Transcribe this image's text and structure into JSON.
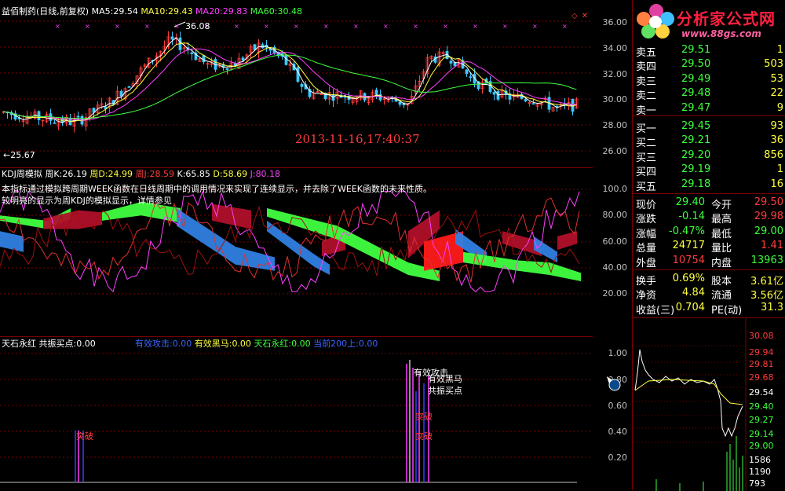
{
  "colors": {
    "bg": "#000000",
    "up": "#ff3c3c",
    "down": "#3cc8ff",
    "ma5": "#ffffff",
    "ma10": "#ffff40",
    "ma20": "#ff40ff",
    "ma60": "#40ff40",
    "grid": "#7a0000"
  },
  "main": {
    "title": "益佰制药(日线,前复权)",
    "ma5_label": "MA5:",
    "ma5": "29.54",
    "ma10_label": "MA10:",
    "ma10": "29.43",
    "ma20_label": "MA20:",
    "ma20": "29.83",
    "ma60_label": "MA60:",
    "ma60": "30.48",
    "high_marker": "36.08",
    "low_marker": "←25.67",
    "timestamp": "2013-11-16,17:40:37",
    "axis": [
      "36.00",
      "34.00",
      "32.00",
      "30.00",
      "28.00",
      "26.00"
    ]
  },
  "kdj": {
    "title": "KDJ周模拟",
    "k_label": "周K:",
    "k": "26.19",
    "d_label": "周D:",
    "d": "24.99",
    "j_label": "周J:",
    "j": "28.59",
    "k2_label": "K:",
    "k2": "65.85",
    "d2_label": "D:",
    "d2": "58.69",
    "j2_label": "J:",
    "j2": "80.18",
    "desc1": "本指标通过模拟跨周期WEEK函数在日线周期中的调用情况来实现了连续显示，并去除了WEEK函数的未来性质。",
    "desc2": "较明亮的显示为周KDJ的模拟显示，详情参见",
    "axis": [
      "100.0",
      "80.00",
      "60.00",
      "40.00",
      "20.00"
    ]
  },
  "signal": {
    "title": "天石永红",
    "f1_label": "共振买点:",
    "f1": "0.00",
    "f2_label": "有效攻击:",
    "f2": "0.00",
    "f3_label": "有效黑马:",
    "f3": "0.00",
    "f4_label": "天石永红:",
    "f4": "0.00",
    "f5_label": "当前200上:",
    "f5": "0.00",
    "axis": [
      "1.00",
      "0.80",
      "0.60",
      "0.40",
      "0.20"
    ],
    "ann_breakthrough": "突破",
    "ann_attack": "有效攻击",
    "ann_darkhorse": "有效黑马",
    "ann_buy": "共振买点",
    "ann_mid": "突破",
    "ann_low": "突破"
  },
  "logo": {
    "brand": "分析家公式网",
    "url": "www.88gs.com"
  },
  "orderbook": {
    "sell": [
      {
        "label": "卖五",
        "price": "29.51",
        "vol": "1"
      },
      {
        "label": "卖四",
        "price": "29.50",
        "vol": "503"
      },
      {
        "label": "卖三",
        "price": "29.49",
        "vol": "53"
      },
      {
        "label": "卖二",
        "price": "29.48",
        "vol": "22"
      },
      {
        "label": "卖一",
        "price": "29.47",
        "vol": "9"
      }
    ],
    "buy": [
      {
        "label": "买一",
        "price": "29.45",
        "vol": "93"
      },
      {
        "label": "买二",
        "price": "29.21",
        "vol": "36"
      },
      {
        "label": "买三",
        "price": "29.20",
        "vol": "856"
      },
      {
        "label": "买四",
        "price": "29.19",
        "vol": "1"
      },
      {
        "label": "买五",
        "price": "29.18",
        "vol": "16"
      }
    ]
  },
  "quote": {
    "rows": [
      {
        "l1": "现价",
        "v1": "29.40",
        "l2": "今开",
        "v2": "29.50"
      },
      {
        "l1": "涨跌",
        "v1": "-0.14",
        "l2": "最高",
        "v2": "29.98"
      },
      {
        "l1": "涨幅",
        "v1": "-0.47%",
        "l2": "最低",
        "v2": "29.00"
      },
      {
        "l1": "总量",
        "v1": "24717",
        "l2": "量比",
        "v2": "1.41"
      },
      {
        "l1": "外盘",
        "v1": "10754",
        "l2": "内盘",
        "v2": "13963"
      }
    ],
    "rows2": [
      {
        "l1": "换手",
        "v1": "0.69%",
        "l2": "股本",
        "v2": "3.61亿"
      },
      {
        "l1": "净资",
        "v1": "4.84",
        "l2": "流通",
        "v2": "3.56亿"
      },
      {
        "l1": "收益(三)",
        "v1": "0.704",
        "l2": "PE(动)",
        "v2": "31.3"
      }
    ]
  },
  "intraday": {
    "axis": [
      "30.08",
      "29.94",
      "29.81",
      "29.68",
      "29.54",
      "29.40",
      "29.27",
      "29.14",
      "29.00"
    ],
    "vol_axis": [
      "1586",
      "1190",
      "793"
    ]
  }
}
